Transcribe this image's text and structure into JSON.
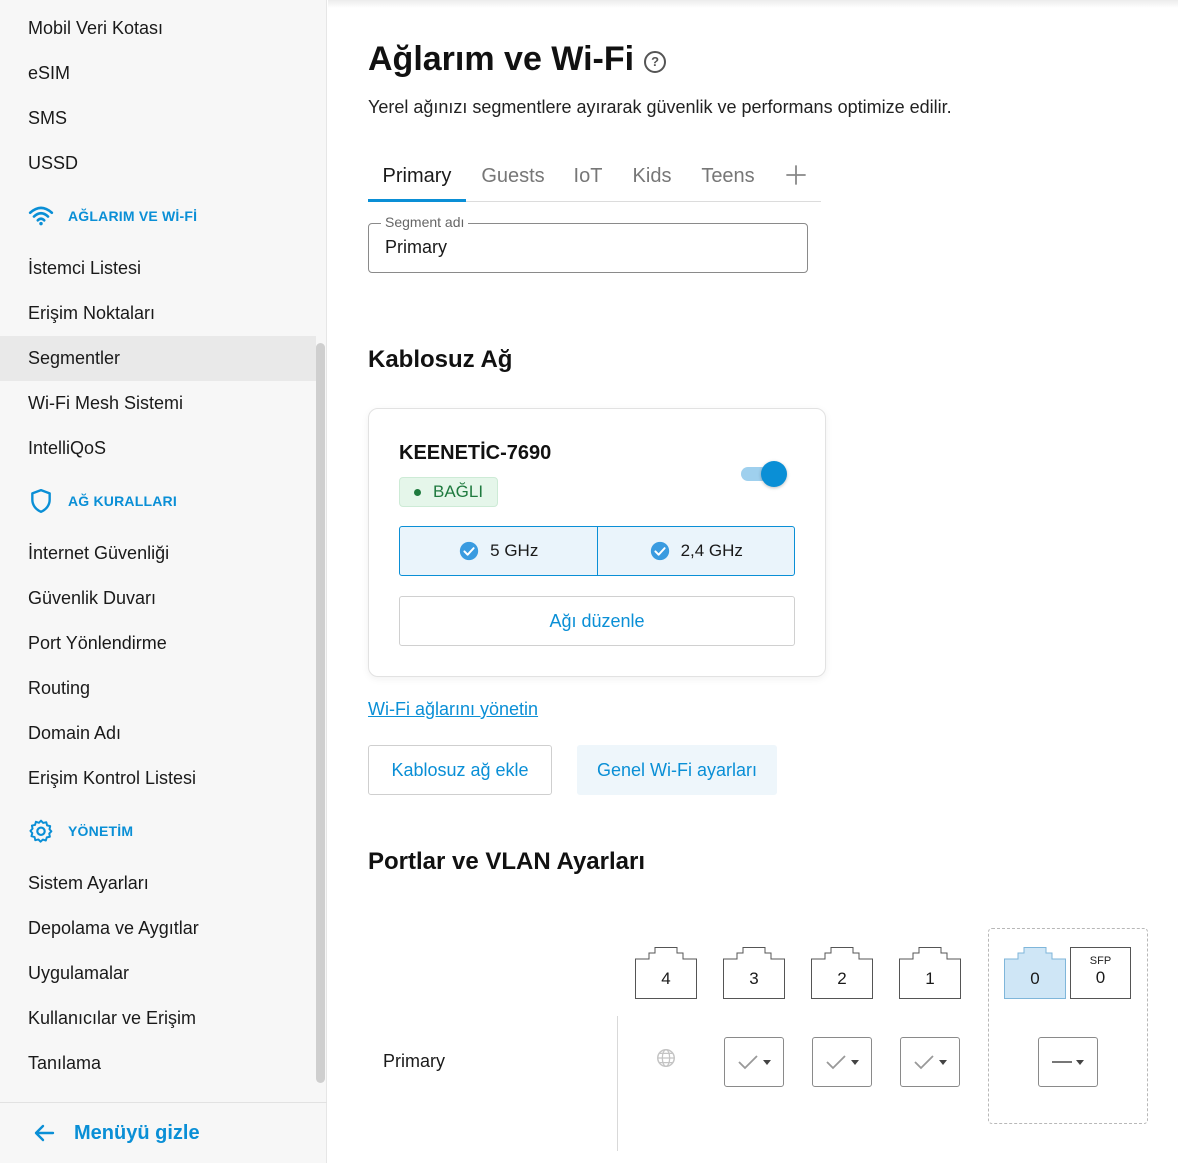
{
  "sidebar": {
    "items_top": [
      {
        "label": "Mobil Veri Kotası"
      },
      {
        "label": "eSIM"
      },
      {
        "label": "SMS"
      },
      {
        "label": "USSD"
      }
    ],
    "group_networks": {
      "title": "AĞLARIM VE Wİ-Fİ",
      "icon": "wifi-icon",
      "items": [
        {
          "label": "İstemci Listesi"
        },
        {
          "label": "Erişim Noktaları"
        },
        {
          "label": "Segmentler",
          "active": true
        },
        {
          "label": "Wi-Fi Mesh Sistemi"
        },
        {
          "label": "IntelliQoS"
        }
      ]
    },
    "group_rules": {
      "title": "AĞ KURALLARI",
      "icon": "shield-icon",
      "items": [
        {
          "label": "İnternet Güvenliği"
        },
        {
          "label": "Güvenlik Duvarı"
        },
        {
          "label": "Port Yönlendirme"
        },
        {
          "label": "Routing"
        },
        {
          "label": "Domain Adı"
        },
        {
          "label": "Erişim Kontrol Listesi"
        }
      ]
    },
    "group_admin": {
      "title": "YÖNETİM",
      "icon": "gear-icon",
      "items": [
        {
          "label": "Sistem Ayarları"
        },
        {
          "label": "Depolama ve Aygıtlar"
        },
        {
          "label": "Uygulamalar"
        },
        {
          "label": "Kullanıcılar ve Erişim"
        },
        {
          "label": "Tanılama"
        }
      ]
    },
    "footer": {
      "label": "Menüyü gizle",
      "icon": "arrow-left-icon"
    }
  },
  "page": {
    "title": "Ağlarım ve Wi-Fi",
    "help_icon": "?",
    "description": "Yerel ağınızı segmentlere ayırarak güvenlik ve performans optimize edilir."
  },
  "tabs": [
    {
      "label": "Primary",
      "active": true
    },
    {
      "label": "Guests"
    },
    {
      "label": "IoT"
    },
    {
      "label": "Kids"
    },
    {
      "label": "Teens"
    }
  ],
  "segment_name": {
    "legend": "Segment adı",
    "value": "Primary"
  },
  "wireless": {
    "section_title": "Kablosuz Ağ",
    "ssid": "KEENETİC-7690",
    "status": "BAĞLI",
    "enabled": true,
    "bands": [
      {
        "label": "5 GHz",
        "checked": true
      },
      {
        "label": "2,4 GHz",
        "checked": true
      }
    ],
    "edit_button": "Ağı düzenle",
    "manage_link": "Wi-Fi ağlarını yönetin",
    "add_button": "Kablosuz ağ ekle",
    "general_button": "Genel Wi-Fi ayarları"
  },
  "ports": {
    "section_title": "Portlar ve VLAN Ayarları",
    "ethernet": [
      "4",
      "3",
      "2",
      "1",
      "0"
    ],
    "sfp": {
      "tag": "SFP",
      "number": "0"
    },
    "row_label": "Primary",
    "colors": {
      "accent": "#0a8fd6",
      "selected_port": "#cfe6f6",
      "badge_bg": "#e5f6ea"
    }
  }
}
